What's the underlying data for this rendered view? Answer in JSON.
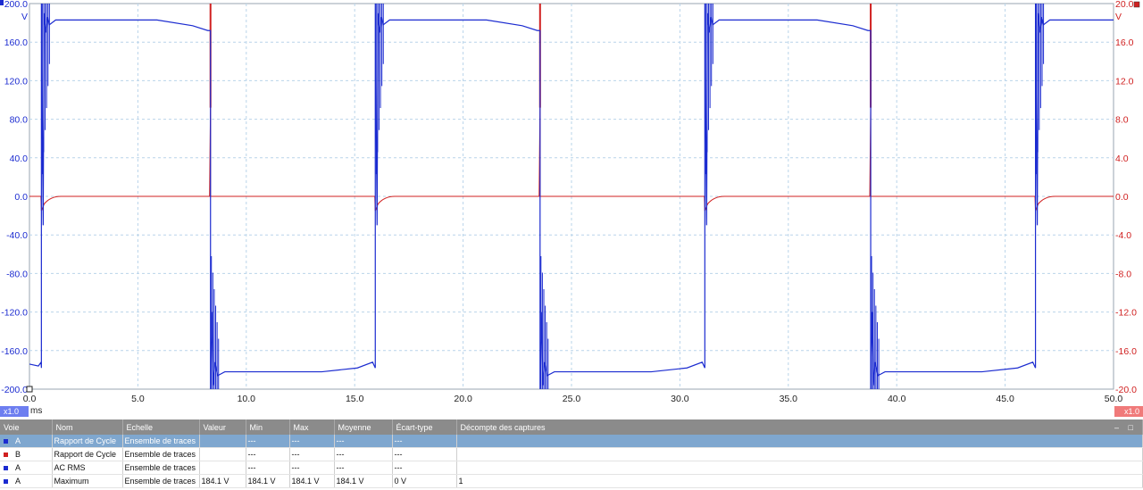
{
  "scope": {
    "x_axis": {
      "ticks": [
        "0.0",
        "5.0",
        "10.0",
        "15.0",
        "20.0",
        "25.0",
        "30.0",
        "35.0",
        "40.0",
        "45.0",
        "50.0"
      ],
      "unit": "ms",
      "range": [
        0,
        50
      ]
    },
    "y_left": {
      "unit": "V",
      "color": "#1b2bd0",
      "range": [
        -200,
        200
      ],
      "ticks": [
        "200.0",
        "160.0",
        "120.0",
        "80.0",
        "40.0",
        "0.0",
        "-40.0",
        "-80.0",
        "-120.0",
        "-160.0",
        "-200.0"
      ]
    },
    "y_right": {
      "unit": "V",
      "color": "#d02020",
      "range": [
        -20,
        20
      ],
      "ticks": [
        "20.0",
        "16.0",
        "12.0",
        "8.0",
        "4.0",
        "0.0",
        "-4.0",
        "-8.0",
        "-12.0",
        "-16.0",
        "-20.0"
      ]
    },
    "zoom_left": "x1.0",
    "zoom_right": "x1.0",
    "grid_color": "#b9d4ea",
    "channel_a": {
      "name": "A",
      "color": "#1b2bd0",
      "high": 183,
      "low": -182,
      "edges_ms": [
        0.55,
        8.35,
        15.95,
        23.55,
        31.15,
        38.8,
        46.4
      ]
    },
    "channel_b": {
      "name": "B",
      "color": "#d02020",
      "level": 0.0,
      "rise_spike_top": 20.0,
      "rise_spike_bottom": 9.2
    }
  },
  "measurements": {
    "columns": [
      "Voie",
      "Nom",
      "Echelle",
      "Valeur",
      "Min",
      "Max",
      "Moyenne",
      "Écart-type",
      "Décompte des captures"
    ],
    "rows": [
      {
        "channel": "A",
        "color": "#1b2bd0",
        "selected": true,
        "cells": [
          "A",
          "Rapport de Cycle",
          "Ensemble de traces",
          "",
          "---",
          "---",
          "---",
          "---",
          ""
        ]
      },
      {
        "channel": "B",
        "color": "#d02020",
        "selected": false,
        "cells": [
          "B",
          "Rapport de Cycle",
          "Ensemble de traces",
          "",
          "---",
          "---",
          "---",
          "---",
          ""
        ]
      },
      {
        "channel": "A",
        "color": "#1b2bd0",
        "selected": false,
        "cells": [
          "A",
          "AC RMS",
          "Ensemble de traces",
          "",
          "---",
          "---",
          "---",
          "---",
          ""
        ]
      },
      {
        "channel": "A",
        "color": "#1b2bd0",
        "selected": false,
        "cells": [
          "A",
          "Maximum",
          "Ensemble de traces",
          "184.1 V",
          "184.1 V",
          "184.1 V",
          "184.1 V",
          "0 V",
          "1"
        ]
      }
    ],
    "window_controls": "– □"
  }
}
